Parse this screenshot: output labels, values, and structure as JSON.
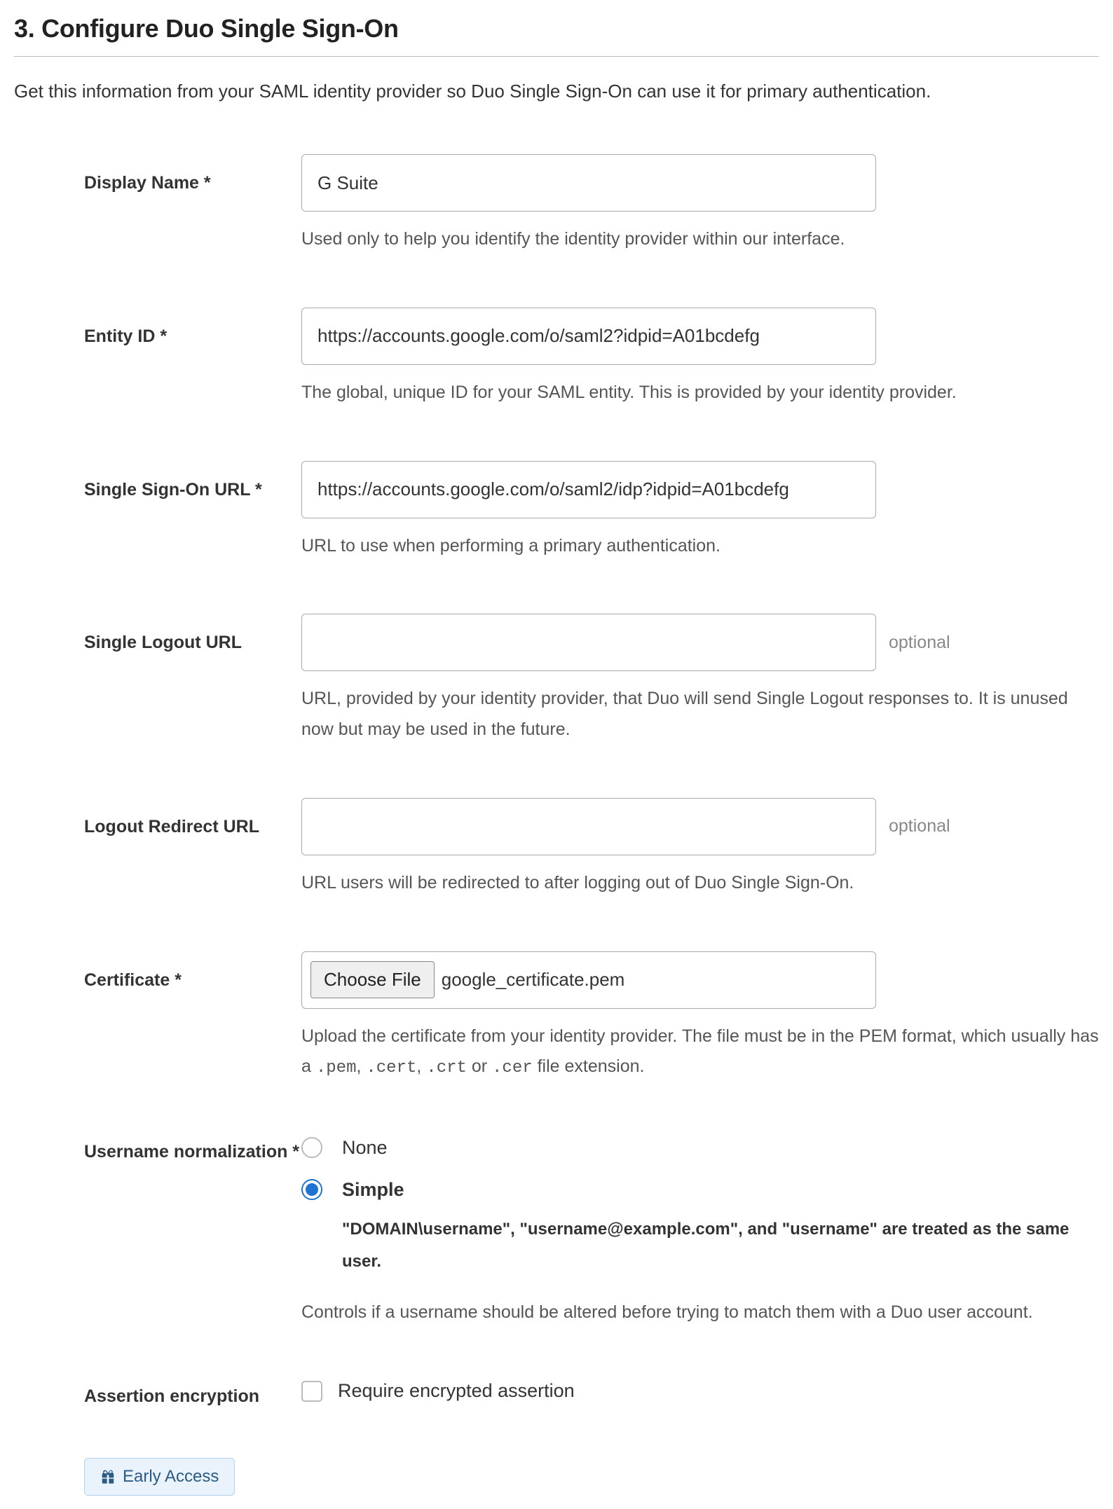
{
  "section": {
    "title": "3. Configure Duo Single Sign-On",
    "description": "Get this information from your SAML identity provider so Duo Single Sign-On can use it for primary authentication."
  },
  "fields": {
    "display_name": {
      "label": "Display Name *",
      "value": "G Suite",
      "help": "Used only to help you identify the identity provider within our interface."
    },
    "entity_id": {
      "label": "Entity ID *",
      "value": "https://accounts.google.com/o/saml2?idpid=A01bcdefg",
      "help": "The global, unique ID for your SAML entity. This is provided by your identity provider."
    },
    "sso_url": {
      "label": "Single Sign-On URL *",
      "value": "https://accounts.google.com/o/saml2/idp?idpid=A01bcdefg",
      "help": "URL to use when performing a primary authentication."
    },
    "slo_url": {
      "label": "Single Logout URL",
      "value": "",
      "optional": "optional",
      "help": "URL, provided by your identity provider, that Duo will send Single Logout responses to. It is unused now but may be used in the future."
    },
    "logout_redirect": {
      "label": "Logout Redirect URL",
      "value": "",
      "optional": "optional",
      "help": "URL users will be redirected to after logging out of Duo Single Sign-On."
    },
    "certificate": {
      "label": "Certificate *",
      "button": "Choose File",
      "filename": "google_certificate.pem",
      "help_prefix": "Upload the certificate from your identity provider. The file must be in the PEM format, which usually has a ",
      "ext1": ".pem",
      "ext2": ".cert",
      "ext3": ".crt",
      "ext4": ".cer",
      "help_suffix": " file extension.",
      "sep_comma": ", ",
      "sep_or": " or "
    },
    "username_norm": {
      "label": "Username normalization *",
      "option_none": "None",
      "option_simple": "Simple",
      "simple_desc": "\"DOMAIN\\username\", \"username@example.com\", and \"username\" are treated as the same user.",
      "help": "Controls if a username should be altered before trying to match them with a Duo user account."
    },
    "assertion_encryption": {
      "label": "Assertion encryption",
      "checkbox_label": "Require encrypted assertion",
      "badge": "Early Access"
    }
  }
}
